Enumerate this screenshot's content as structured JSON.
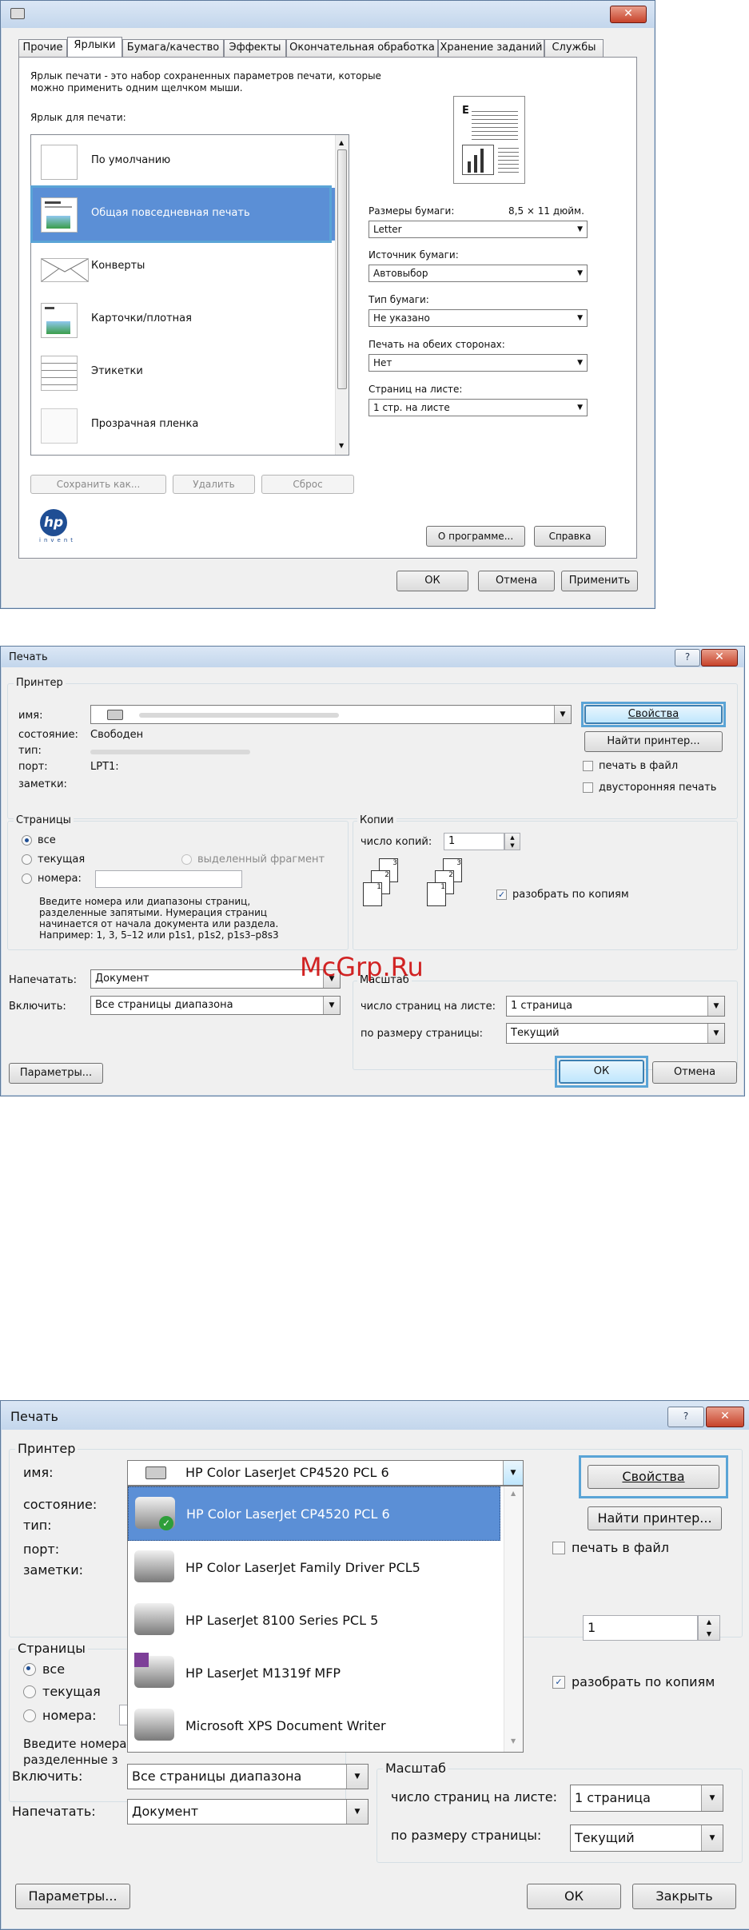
{
  "dlg1": {
    "tabs": [
      "Прочие",
      "Ярлыки",
      "Бумага/качество",
      "Эффекты",
      "Окончательная обработка",
      "Хранение заданий",
      "Службы"
    ],
    "intro": [
      "Ярлык печати - это набор сохраненных параметров печати, которые",
      "можно применить одним щелчком мыши."
    ],
    "list_label": "Ярлык для печати:",
    "shortcuts": [
      "По умолчанию",
      "Общая повседневная печать",
      "Конверты",
      "Карточки/плотная",
      "Этикетки",
      "Прозрачная пленка"
    ],
    "paper_size_label": "Размеры бумаги:",
    "paper_size_dim": "8,5 × 11 дюйм.",
    "paper_size_value": "Letter",
    "source_label": "Источник бумаги:",
    "source_value": "Автовыбор",
    "type_label": "Тип бумаги:",
    "type_value": "Не указано",
    "duplex_label": "Печать на обеих сторонах:",
    "duplex_value": "Нет",
    "pages_label": "Страниц на листе:",
    "pages_value": "1 стр. на листе",
    "save_as": "Сохранить как...",
    "delete": "Удалить",
    "reset": "Сброс",
    "about": "О программе...",
    "help": "Справка",
    "ok": "ОК",
    "cancel": "Отмена",
    "apply": "Применить",
    "hp_sub": "invent"
  },
  "dlg2": {
    "title": "Печать",
    "printer_group": "Принтер",
    "name_label": "имя:",
    "status_label": "состояние:",
    "status_value": "Свободен",
    "type_label": "тип:",
    "port_label": "порт:",
    "port_value": "LPT1:",
    "notes_label": "заметки:",
    "properties": "Свойства",
    "find_printer": "Найти принтер...",
    "print_to_file": "печать в файл",
    "duplex": "двусторонняя печать",
    "pages_group": "Страницы",
    "all": "все",
    "current": "текущая",
    "selection": "выделенный фрагмент",
    "pages_numbers": "номера:",
    "help_text": [
      "Введите номера или диапазоны страниц,",
      "разделенные запятыми. Нумерация страниц",
      "начинается от начала документа или раздела.",
      "Например: 1, 3, 5–12 или p1s1, p1s2, p1s3–p8s3"
    ],
    "copies_group": "Копии",
    "copies_label": "число копий:",
    "copies_value": "1",
    "collate": "разобрать по копиям",
    "print_what_label": "Напечатать:",
    "print_what_value": "Документ",
    "include_label": "Включить:",
    "include_value": "Все страницы диапазона",
    "scale_group": "Масштаб",
    "pages_per_sheet_label": "число страниц на листе:",
    "pages_per_sheet_value": "1 страница",
    "scale_to_label": "по размеру страницы:",
    "scale_to_value": "Текущий",
    "options": "Параметры...",
    "ok": "ОК",
    "cancel": "Отмена",
    "watermark": "McGrp.Ru"
  },
  "dlg3": {
    "title": "Печать",
    "printer_group": "Принтер",
    "name_label": "имя:",
    "status_label": "состояние:",
    "type_label": "тип:",
    "port_label": "порт:",
    "notes_label": "заметки:",
    "selected_printer": "HP Color LaserJet CP4520 PCL 6",
    "printers": [
      "HP Color LaserJet CP4520 PCL 6",
      "HP Color LaserJet Family Driver PCL5",
      "HP LaserJet 8100 Series PCL 5",
      "HP LaserJet M1319f MFP",
      "Microsoft XPS Document Writer"
    ],
    "properties": "Свойства",
    "find_printer": "Найти принтер...",
    "print_to_file": "печать в файл",
    "pages_group": "Страницы",
    "all": "все",
    "current": "текущая",
    "pages_numbers": "номера:",
    "help_text": [
      "Введите номера",
      "разделенные з"
    ],
    "copies_value": "1",
    "collate": "разобрать по копиям",
    "include_label": "Включить:",
    "include_value": "Все страницы диапазона",
    "print_what_label": "Напечатать:",
    "print_what_value": "Документ",
    "scale_group": "Масштаб",
    "pages_per_sheet_label": "число страниц на листе:",
    "pages_per_sheet_value": "1 страница",
    "scale_to_label": "по размеру страницы:",
    "scale_to_value": "Текущий",
    "options": "Параметры...",
    "ok": "ОК",
    "close": "Закрыть"
  },
  "colors": {
    "highlight": "#5aa4d6",
    "selection": "#5b8fd6",
    "watermark": "#cc0000"
  }
}
